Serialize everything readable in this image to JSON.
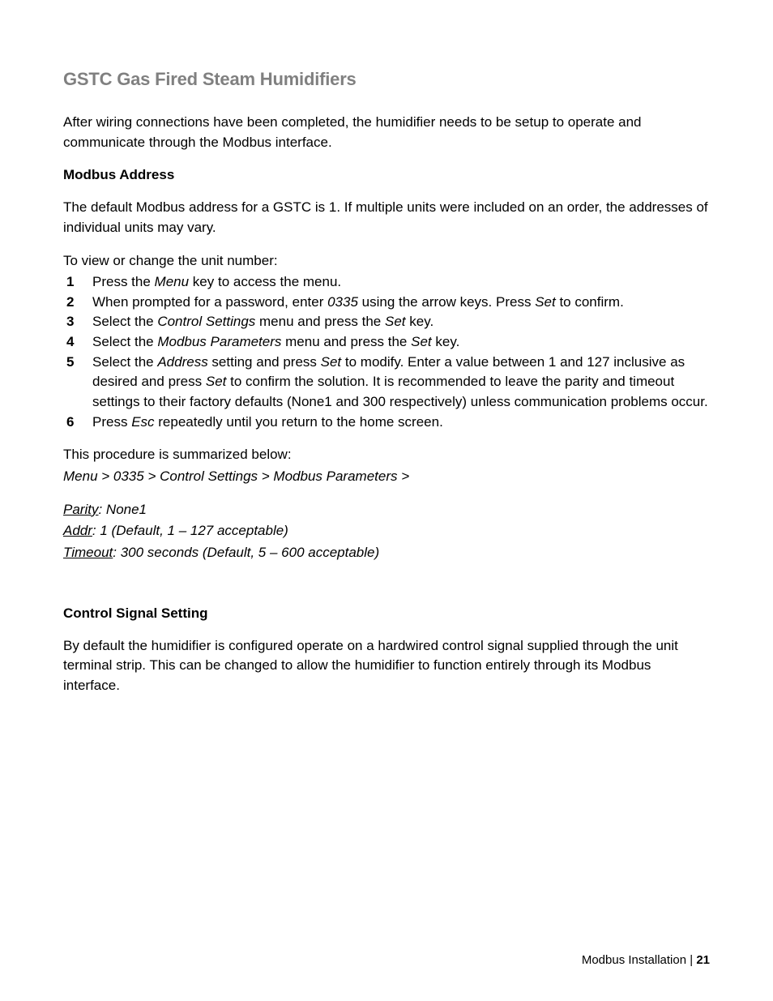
{
  "title": "GSTC Gas Fired Steam Humidifiers",
  "intro": "After wiring connections have been completed, the humidifier needs to be setup to operate and communicate through the Modbus interface.",
  "sec1": {
    "heading": "Modbus Address",
    "p1": "The default Modbus address for a GSTC is 1.  If multiple units were included on an order, the addresses of individual units may vary.",
    "p2": "To view or change the unit number:",
    "steps": {
      "n1": "1",
      "s1a": "Press the ",
      "s1b": "Menu",
      "s1c": " key to access the menu.",
      "n2": "2",
      "s2a": "When prompted for a password, enter ",
      "s2b": "0335",
      "s2c": " using the arrow keys.  Press ",
      "s2d": "Set",
      "s2e": " to confirm.",
      "n3": "3",
      "s3a": "Select the ",
      "s3b": "Control Settings",
      "s3c": " menu and press the ",
      "s3d": "Set",
      "s3e": " key.",
      "n4": "4",
      "s4a": "Select the ",
      "s4b": "Modbus Parameters",
      "s4c": " menu and press the ",
      "s4d": "Set",
      "s4e": " key.",
      "n5": "5",
      "s5a": "Select the ",
      "s5b": "Address",
      "s5c": " setting and press ",
      "s5d": "Set",
      "s5e": " to modify.  Enter a value between 1 and 127 inclusive as desired and press ",
      "s5f": "Set",
      "s5g": " to confirm the solution.  It is recommended to leave the parity and timeout settings to their factory defaults (None1 and 300 respectively) unless communication problems occur.",
      "n6": "6",
      "s6a": "Press ",
      "s6b": "Esc",
      "s6c": " repeatedly until you return to the home screen."
    },
    "summary_lead": "This procedure is summarized below:",
    "summary_path": "Menu > 0335 > Control Settings > Modbus Parameters >",
    "params": {
      "parity_label": "Parity",
      "parity_val": ": None1",
      "addr_label": "Addr",
      "addr_val": ": 1 (Default, 1 – 127 acceptable)",
      "timeout_label": "Timeout",
      "timeout_val": ": 300 seconds (Default, 5 – 600 acceptable)"
    }
  },
  "sec2": {
    "heading": "Control Signal Setting",
    "p1": "By default the humidifier is configured operate on a hardwired control signal supplied through the unit terminal strip.  This can be changed to allow the humidifier to function entirely through its Modbus interface."
  },
  "footer": {
    "label": "Modbus Installation | ",
    "page": "21"
  }
}
